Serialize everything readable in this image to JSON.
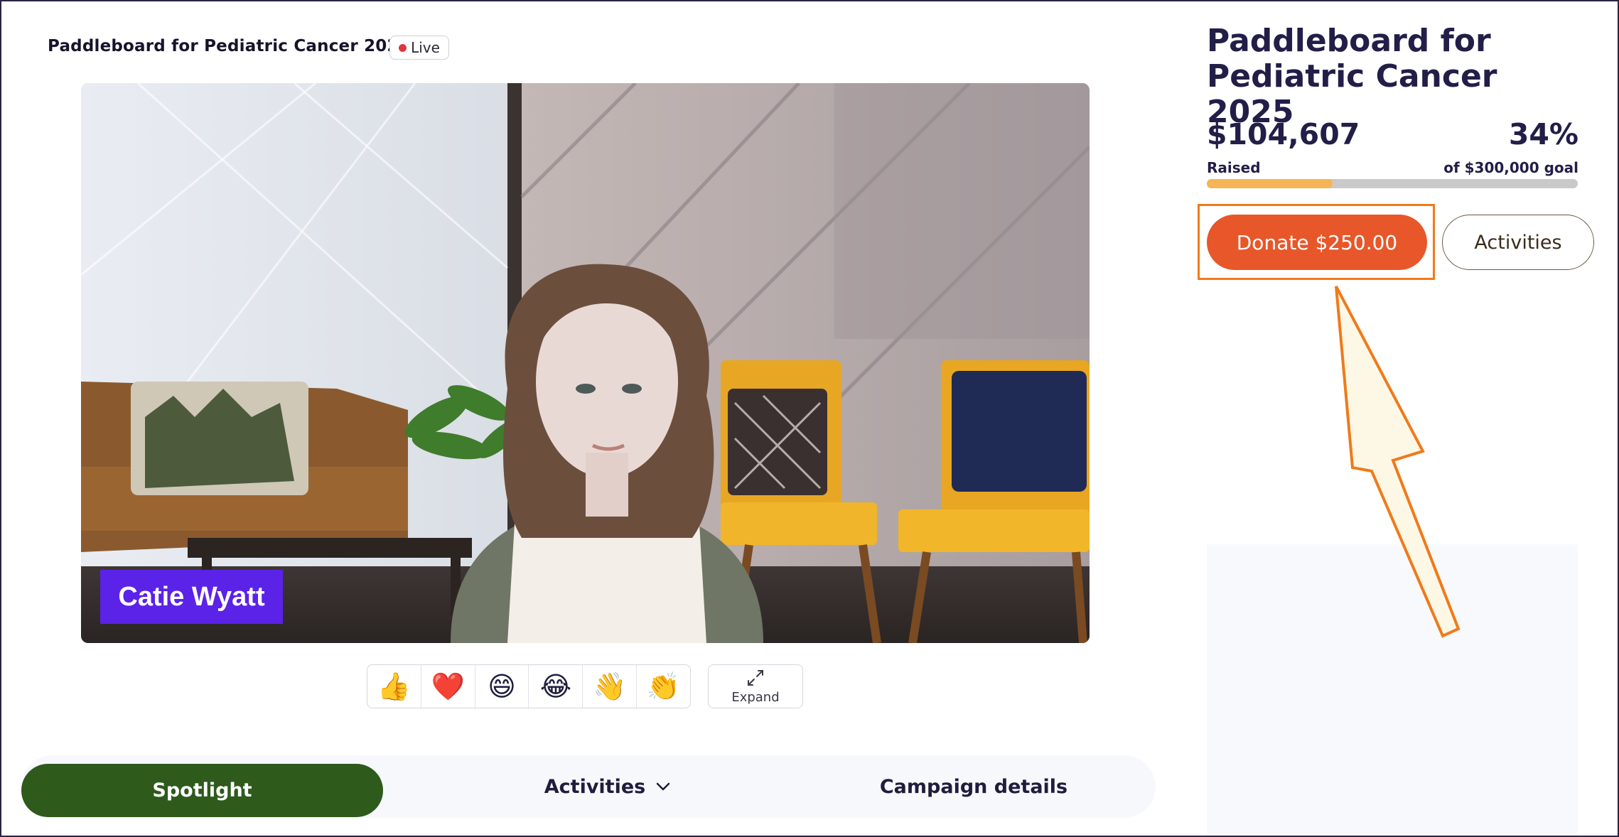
{
  "stream": {
    "title": "Paddleboard for Pediatric Cancer 2025",
    "live_label": "Live"
  },
  "video": {
    "speaker_name": "Catie Wyatt"
  },
  "reactions": [
    {
      "icon": "thumbs-up-icon",
      "glyph": "👍"
    },
    {
      "icon": "heart-icon",
      "glyph": "❤️"
    },
    {
      "icon": "grinning-face-icon",
      "glyph": "😄"
    },
    {
      "icon": "tears-of-joy-icon",
      "glyph": "😂"
    },
    {
      "icon": "waving-hand-icon",
      "glyph": "👋"
    },
    {
      "icon": "clapping-hands-icon",
      "glyph": "👏"
    }
  ],
  "expand": {
    "label": "Expand",
    "icon": "expand-arrows-icon"
  },
  "tabs": {
    "spotlight": "Spotlight",
    "activities": "Activities",
    "campaign_details": "Campaign details"
  },
  "campaign": {
    "title": "Paddleboard for Pediatric Cancer 2025",
    "raised_amount": "$104,607",
    "raised_label": "Raised",
    "percent": "34%",
    "goal_label": "of $300,000 goal",
    "progress_fraction": 0.34,
    "donate_label": "Donate $250.00",
    "activities_label": "Activities"
  },
  "colors": {
    "accent_orange": "#e7572a",
    "highlight": "#f07a1a",
    "spotlight_green": "#2e5a1c",
    "progress_fill": "#f5b555",
    "name_tag": "#5b22e8",
    "title_navy": "#221e48"
  }
}
